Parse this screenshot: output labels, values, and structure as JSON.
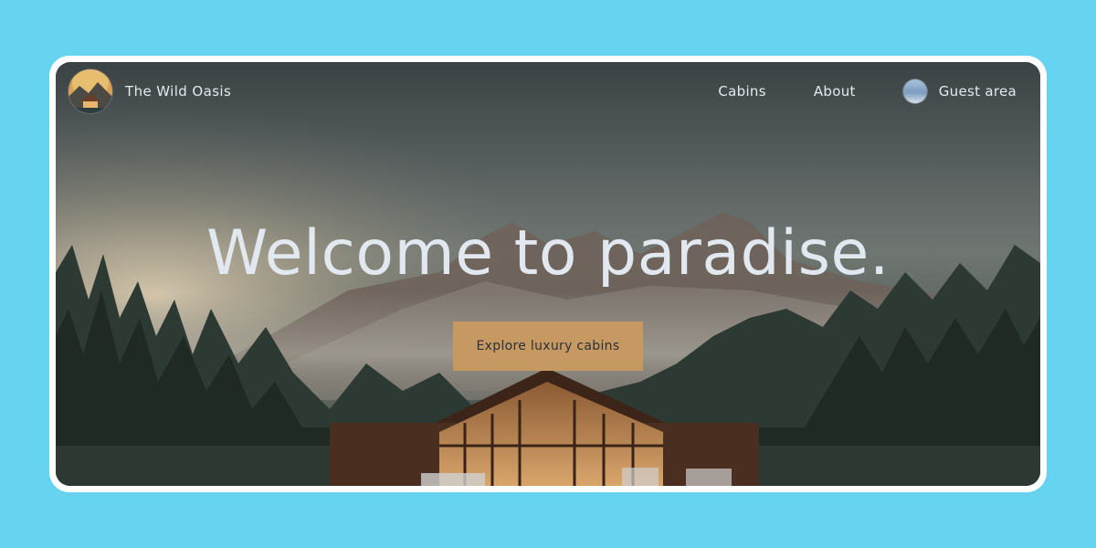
{
  "brand": {
    "name": "The Wild Oasis",
    "logo_icon": "cabin-logo-icon"
  },
  "nav": {
    "items": [
      {
        "label": "Cabins"
      },
      {
        "label": "About"
      }
    ],
    "guest": {
      "label": "Guest area",
      "avatar_icon": "user-avatar-icon"
    }
  },
  "hero": {
    "title": "Welcome to paradise.",
    "cta_label": "Explore luxury cabins"
  },
  "colors": {
    "page_background": "#66d3f1",
    "cta_background": "#c69963",
    "text_light": "#e1e8ef"
  }
}
